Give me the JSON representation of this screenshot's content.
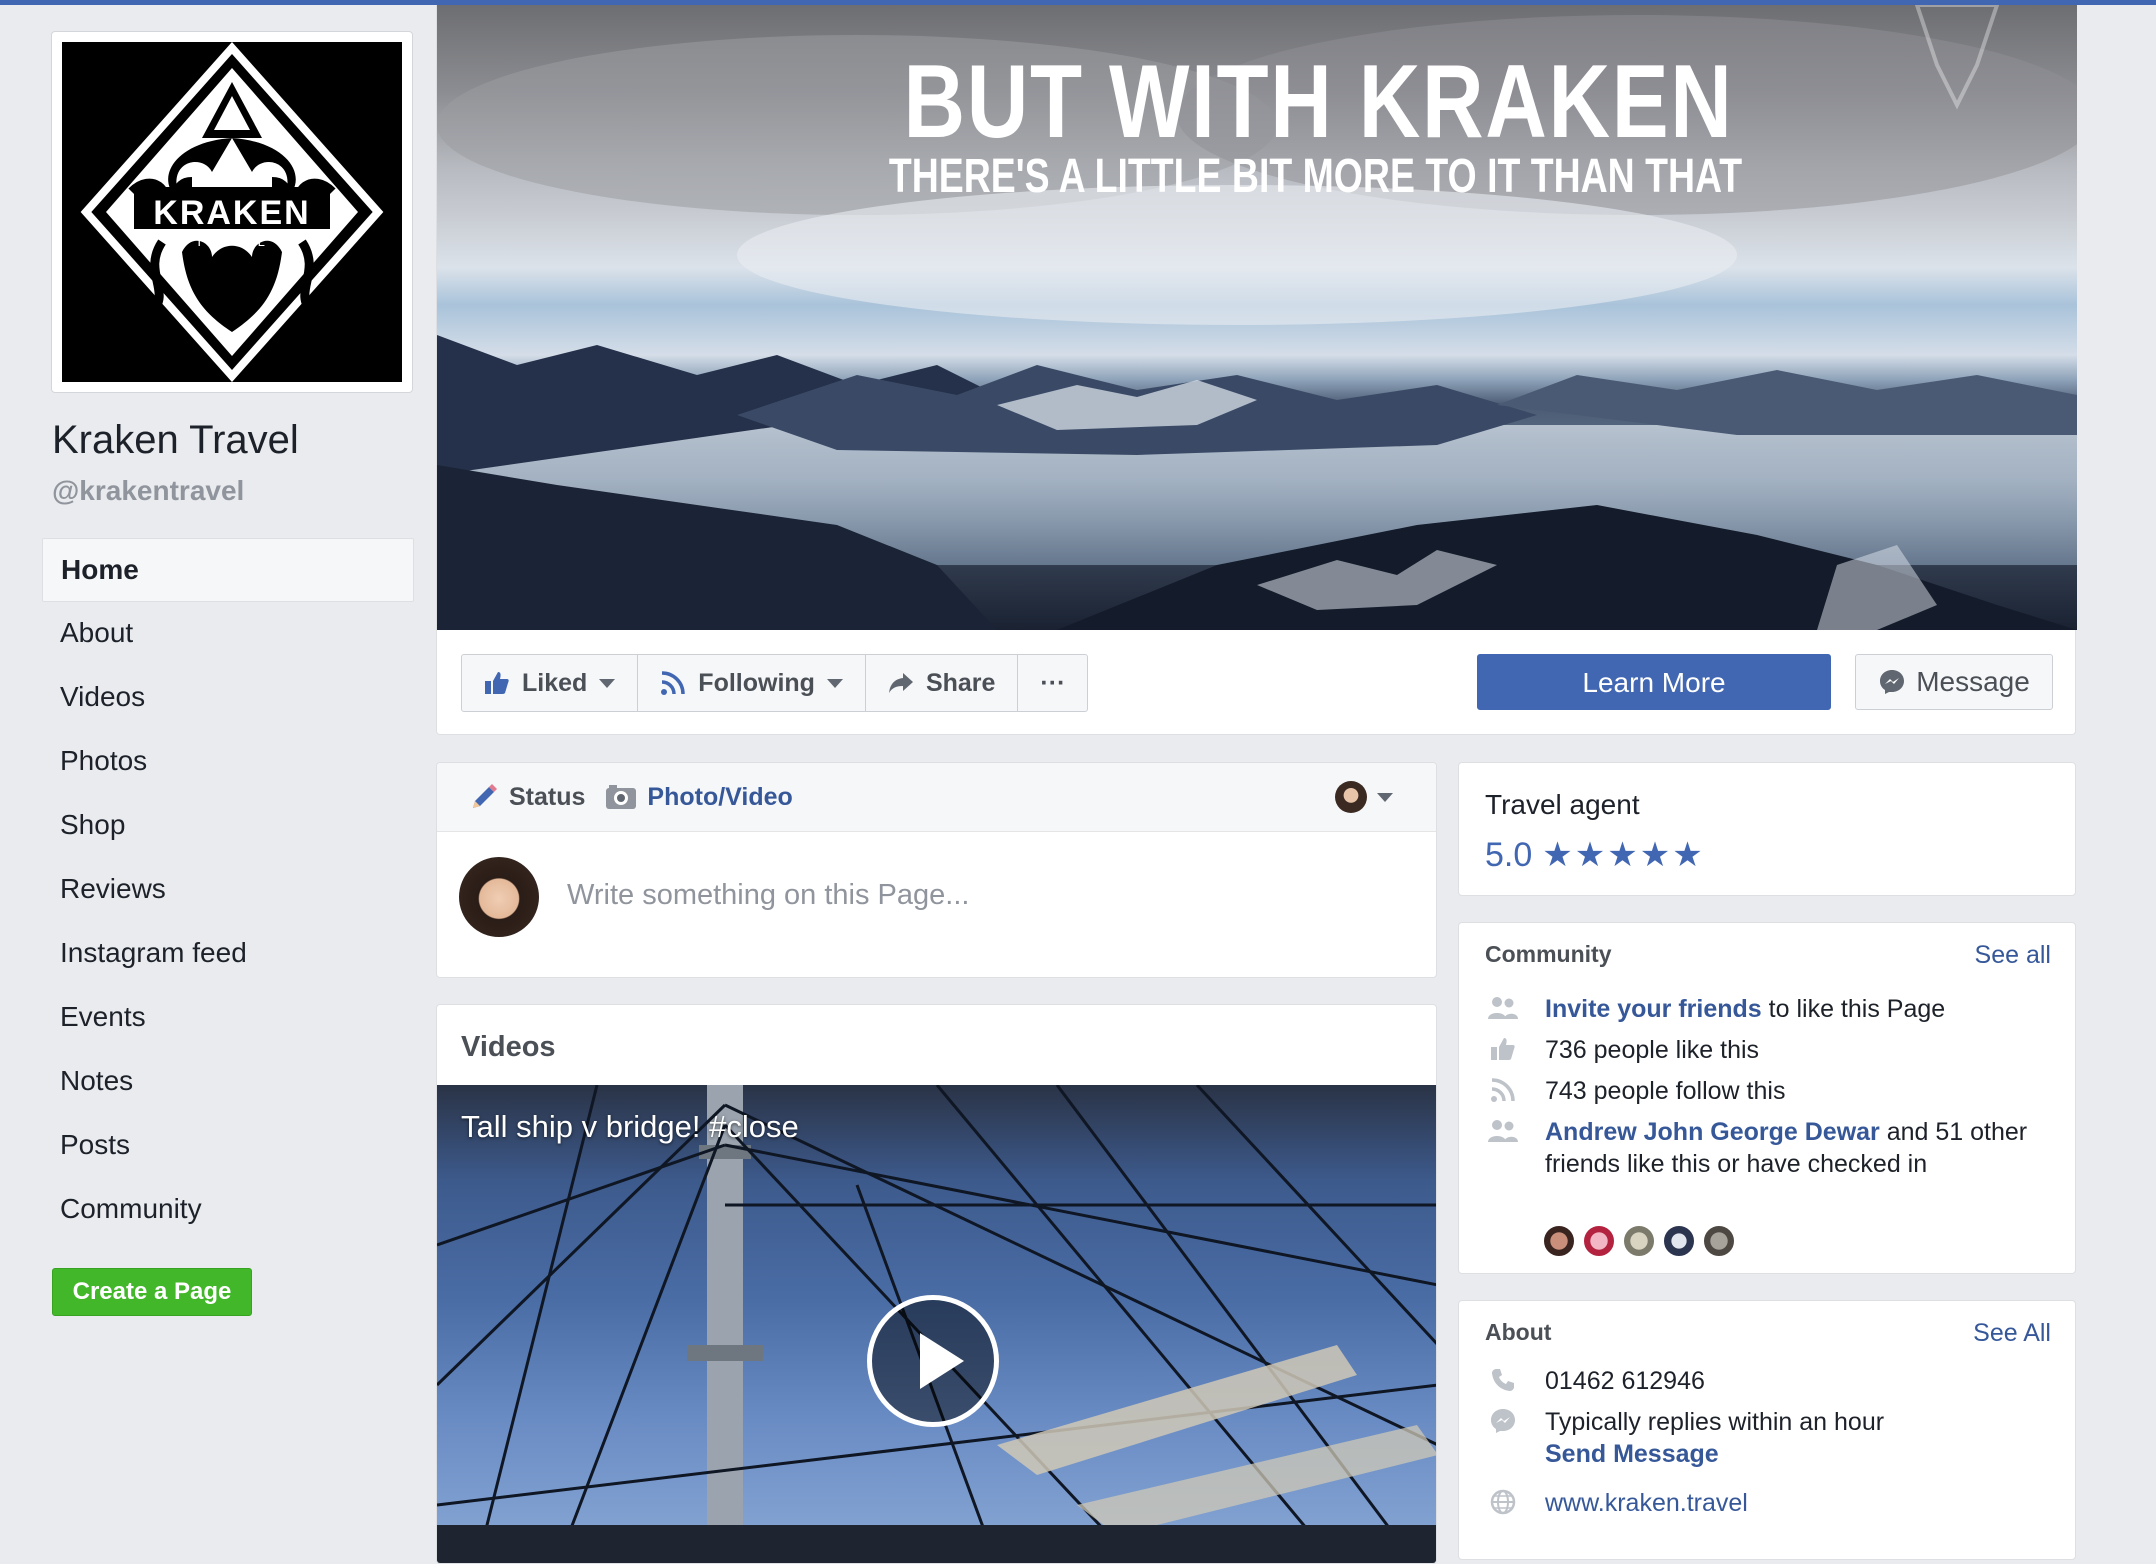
{
  "page": {
    "name": "Kraken Travel",
    "handle": "@krakentravel",
    "logo_name": "KRAKEN",
    "logo_sub": "TRAVEL"
  },
  "nav": {
    "items": [
      "Home",
      "About",
      "Videos",
      "Photos",
      "Shop",
      "Reviews",
      "Instagram feed",
      "Events",
      "Notes",
      "Posts",
      "Community"
    ],
    "active": "Home",
    "create_page_label": "Create a Page"
  },
  "cover": {
    "title": "BUT WITH KRAKEN",
    "subtitle": "THERE'S A LITTLE BIT MORE TO IT THAN THAT"
  },
  "actions": {
    "liked_label": "Liked",
    "following_label": "Following",
    "share_label": "Share",
    "more_label": "···",
    "learn_more_label": "Learn More",
    "message_label": "Message"
  },
  "composer": {
    "status_label": "Status",
    "photo_video_label": "Photo/Video",
    "placeholder": "Write something on this Page..."
  },
  "videos": {
    "section_title": "Videos",
    "caption": "Tall ship v bridge! #close"
  },
  "category": {
    "label": "Travel agent",
    "rating": "5.0",
    "stars": "★★★★★"
  },
  "community": {
    "title": "Community",
    "see_all": "See all",
    "invite_link": "Invite your friends",
    "invite_rest": " to like this Page",
    "likes_text": "736 people like this",
    "follows_text": "743 people follow this",
    "friend_name": "Andrew John George Dewar",
    "friend_rest_1": " and 51 other",
    "friend_rest_2": "friends like this or have checked in"
  },
  "about": {
    "title": "About",
    "see_all": "See All",
    "phone": "01462 612946",
    "reply_text": "Typically replies within an hour",
    "send_message": "Send Message",
    "website": "www.kraken.travel"
  },
  "colors": {
    "brand_blue": "#4267b2",
    "link_blue": "#365899",
    "create_green": "#42b72a",
    "background": "#e9ebee"
  }
}
